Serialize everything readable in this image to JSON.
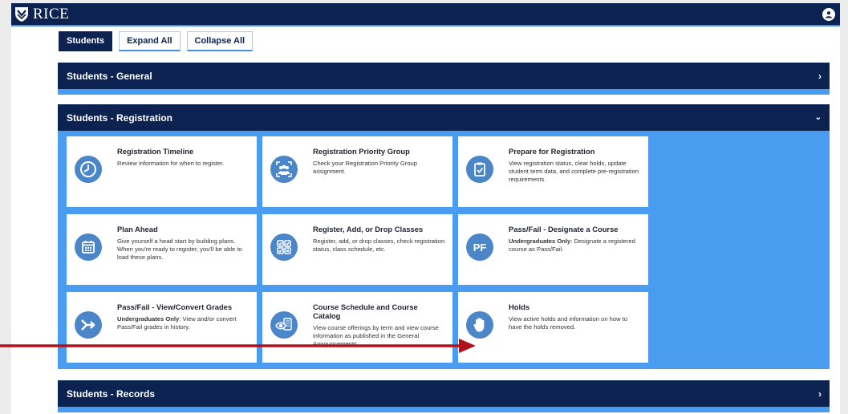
{
  "header": {
    "logo_text": "RICE",
    "logo_icon": "rice-shield-icon",
    "user_icon": "user-avatar-icon"
  },
  "toolbar": {
    "tabs": [
      {
        "label": "Students",
        "active": true
      },
      {
        "label": "Expand All",
        "active": false
      },
      {
        "label": "Collapse All",
        "active": false
      }
    ]
  },
  "sections": {
    "general": {
      "title": "Students - General",
      "state": "collapsed"
    },
    "registration": {
      "title": "Students - Registration",
      "state": "expanded"
    },
    "records": {
      "title": "Students - Records",
      "state": "collapsed"
    }
  },
  "cards": [
    {
      "title": "Registration Timeline",
      "desc": "Review information for when to register.",
      "icon": "clock-icon"
    },
    {
      "title": "Registration Priority Group",
      "desc": "Check your Registration Priority Group assignment.",
      "icon": "group-icon"
    },
    {
      "title": "Prepare for Registration",
      "desc": "View registration status, clear holds, update student term data, and complete pre-registration requirements.",
      "icon": "clipboard-check-icon"
    },
    {
      "title": "Plan Ahead",
      "desc": "Give yourself a head start by building plans. When you're ready to register, you'll be able to load these plans.",
      "icon": "calendar-icon"
    },
    {
      "title": "Register, Add, or Drop Classes",
      "desc": "Register, add, or drop classes, check registration status, class schedule, etc.",
      "icon": "checkbox-grid-icon"
    },
    {
      "title": "Pass/Fail - Designate a Course",
      "desc_bold": "Undergraduates Only",
      "desc": ": Designate a registered course as Pass/Fail.",
      "icon": "pass-fail-icon"
    },
    {
      "title": "Pass/Fail - View/Convert Grades",
      "desc_bold": "Undergraduates Only",
      "desc": ": View and/or convert Pass/Fail grades in history.",
      "icon": "convert-arrow-icon"
    },
    {
      "title": "Course Schedule and Course Catalog",
      "desc": "View course offerings by term and view course information as published in the General Announcements.",
      "icon": "catalog-eye-icon"
    },
    {
      "title": "Holds",
      "desc": "View active holds and information on how to have the holds removed.",
      "icon": "hand-stop-icon"
    }
  ],
  "colors": {
    "navy": "#0c2250",
    "accent_blue": "#4a9cf0",
    "icon_blue": "#4a86c8",
    "annotation_arrow": "#b0121a"
  }
}
